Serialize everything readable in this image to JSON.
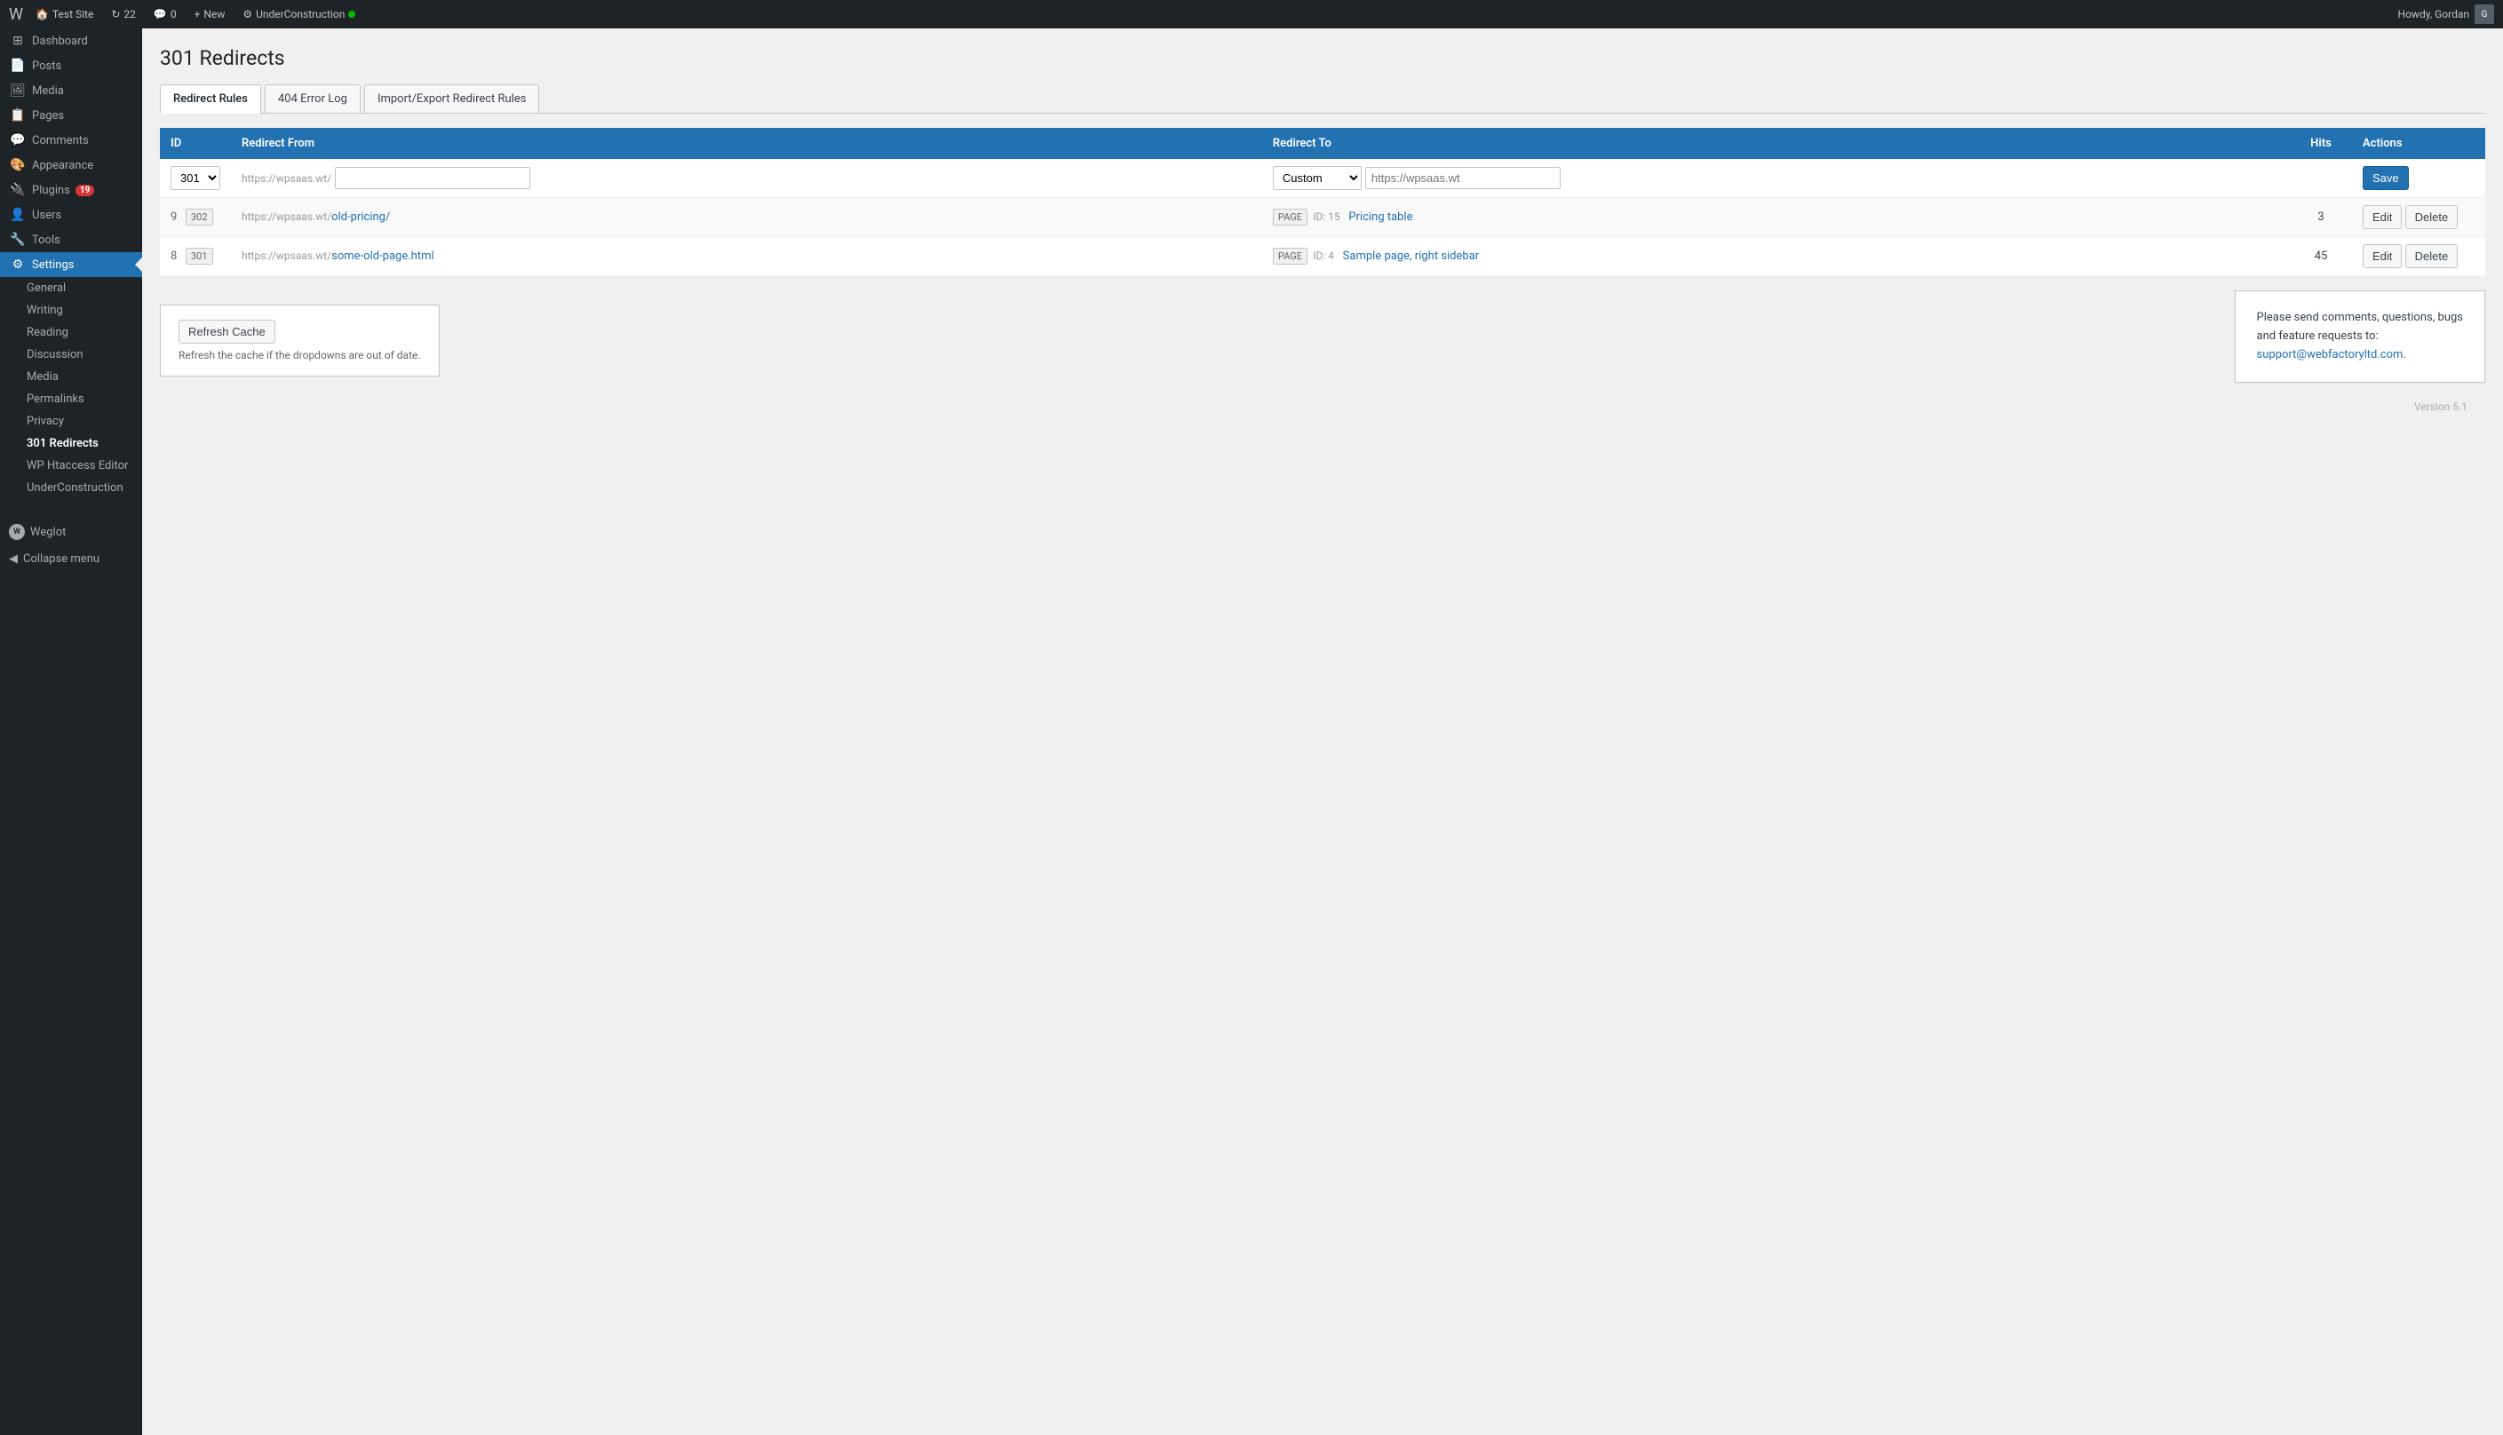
{
  "adminbar": {
    "logo": "W",
    "items": [
      {
        "label": "Test Site",
        "icon": "🏠"
      },
      {
        "label": "22",
        "icon": "↻"
      },
      {
        "label": "0",
        "icon": "💬"
      },
      {
        "label": "New",
        "icon": "+"
      },
      {
        "label": "UnderConstruction",
        "icon": "⚙",
        "dot": true
      }
    ],
    "right": "Howdy, Gordan"
  },
  "sidebar": {
    "items": [
      {
        "label": "Dashboard",
        "icon": "⊞",
        "active": false
      },
      {
        "label": "Posts",
        "icon": "📄",
        "active": false
      },
      {
        "label": "Media",
        "icon": "🖼",
        "active": false
      },
      {
        "label": "Pages",
        "icon": "📋",
        "active": false
      },
      {
        "label": "Comments",
        "icon": "💬",
        "active": false
      },
      {
        "label": "Appearance",
        "icon": "🎨",
        "active": false
      },
      {
        "label": "Plugins",
        "icon": "🔌",
        "active": false,
        "badge": "19"
      },
      {
        "label": "Users",
        "icon": "👤",
        "active": false
      },
      {
        "label": "Tools",
        "icon": "🔧",
        "active": false
      },
      {
        "label": "Settings",
        "icon": "⚙",
        "active": true
      }
    ],
    "submenu": [
      {
        "label": "General",
        "active": false
      },
      {
        "label": "Writing",
        "active": false
      },
      {
        "label": "Reading",
        "active": false
      },
      {
        "label": "Discussion",
        "active": false
      },
      {
        "label": "Media",
        "active": false
      },
      {
        "label": "Permalinks",
        "active": false
      },
      {
        "label": "Privacy",
        "active": false
      },
      {
        "label": "301 Redirects",
        "active": true
      },
      {
        "label": "WP Htaccess Editor",
        "active": false
      },
      {
        "label": "UnderConstruction",
        "active": false
      }
    ],
    "weglot_label": "Weglot",
    "collapse_label": "Collapse menu"
  },
  "page": {
    "title": "301 Redirects",
    "tabs": [
      {
        "label": "Redirect Rules",
        "active": true
      },
      {
        "label": "404 Error Log",
        "active": false
      },
      {
        "label": "Import/Export Redirect Rules",
        "active": false
      }
    ],
    "table": {
      "headers": [
        {
          "label": "ID"
        },
        {
          "label": "Redirect From"
        },
        {
          "label": "Redirect To"
        },
        {
          "label": "Hits"
        },
        {
          "label": "Actions"
        }
      ],
      "new_row": {
        "type_select_value": "301",
        "from_prefix": "https://wpsaas.wt/",
        "from_placeholder": "",
        "to_type_value": "Custom",
        "to_placeholder": "https://wpsaas.wt",
        "save_label": "Save"
      },
      "rows": [
        {
          "id": "9",
          "type": "302",
          "from_prefix": "https://wpsaas.wt/",
          "from_path": "old-pricing/",
          "to_type": "PAGE",
          "to_id": "ID: 15",
          "to_label": "Pricing table",
          "hits": "3",
          "edit_label": "Edit",
          "delete_label": "Delete"
        },
        {
          "id": "8",
          "type": "301",
          "from_prefix": "https://wpsaas.wt/",
          "from_path": "some-old-page.html",
          "to_type": "PAGE",
          "to_id": "ID: 4",
          "to_label": "Sample page, right sidebar",
          "hits": "45",
          "edit_label": "Edit",
          "delete_label": "Delete"
        }
      ]
    },
    "refresh_cache": {
      "button_label": "Refresh Cache",
      "note": "Refresh the cache if the dropdowns are out of date."
    },
    "info_box": {
      "text1": "Please send comments, questions, bugs",
      "text2": "and feature requests to:",
      "email": "support@webfactoryltd.com",
      "email_suffix": "."
    },
    "version": "Version 5.1"
  }
}
